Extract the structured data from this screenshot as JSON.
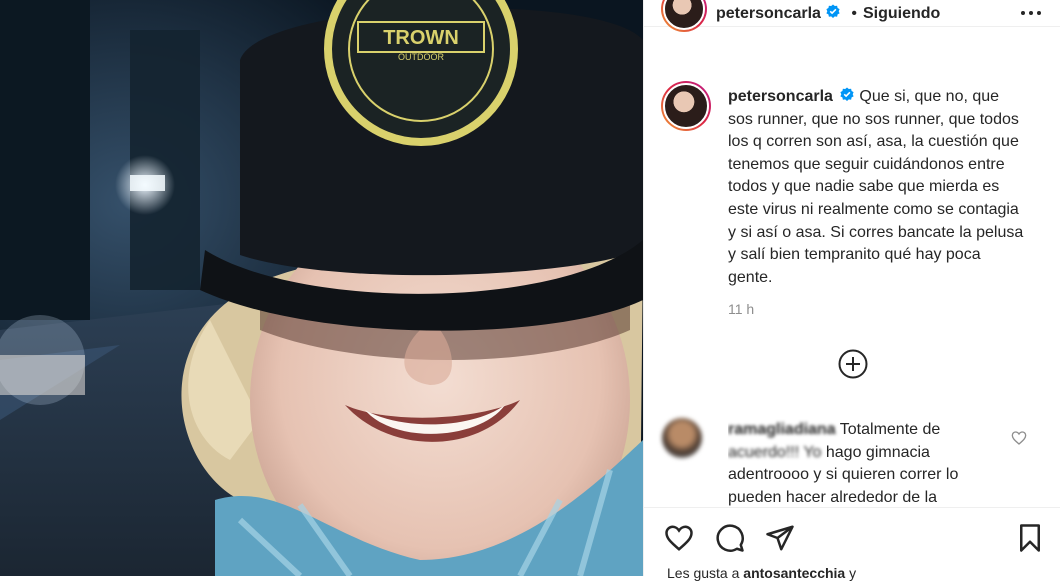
{
  "post": {
    "image_alt": "Selfie nocturna con gorra TROWN",
    "cap_brand": "TROWN",
    "cap_subtext": "OUTDOOR"
  },
  "header": {
    "username": "petersoncarla",
    "separator": "•",
    "follow_status": "Siguiendo",
    "more_icon": "more-horizontal-icon"
  },
  "caption": {
    "username": "petersoncarla",
    "text": "Que si, que no, que sos runner, que no sos runner, que todos los q corren son así, asa, la cuestión que tenemos que seguir cuidándonos entre todos y que nadie sabe que mierda es este virus ni realmente como se contagia y si así o asa. Si corres bancate la pelusa y salí bien tempranito qué hay poca gente.",
    "timestamp": "11 h"
  },
  "load_more_icon": "plus-circle-icon",
  "comments": [
    {
      "username": "ramagliadiana",
      "text_visible": "Totalmente de",
      "text_blurred": "acuerdo!!! Yo",
      "text_rest": "hago gimnacia adentroooo y si quieren correr lo pueden hacer alrededor de la"
    }
  ],
  "actions": {
    "like_icon": "heart-icon",
    "comment_icon": "comment-icon",
    "share_icon": "share-icon",
    "save_icon": "bookmark-icon"
  },
  "likes": {
    "prefix": "Les gusta a",
    "user": "antosantecchia",
    "suffix": "y"
  },
  "colors": {
    "verified_blue": "#0095f6",
    "text": "#262626",
    "muted": "#8e8e8e",
    "border": "#efefef"
  }
}
